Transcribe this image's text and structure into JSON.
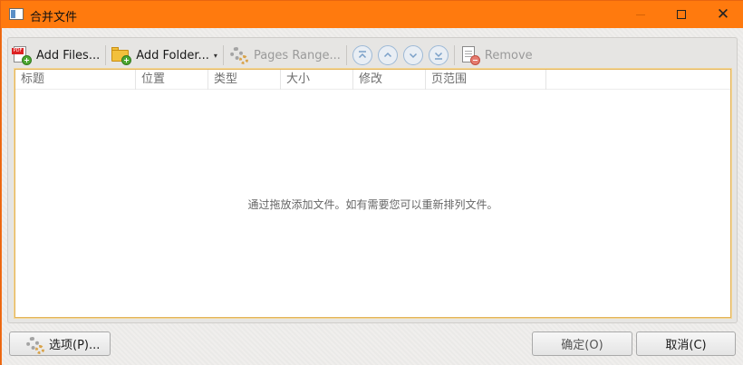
{
  "window": {
    "title": "合并文件",
    "minimize_icon": "minimize-icon",
    "maximize_icon": "maximize-icon",
    "close_icon": "close-icon",
    "close_glyph": "✕"
  },
  "toolbar": {
    "add_files_label": "Add Files...",
    "add_folder_label": "Add Folder...",
    "add_folder_caret": "▾",
    "pages_range_label": "Pages Range...",
    "remove_label": "Remove",
    "nav_icons": [
      "move-to-top-icon",
      "move-up-icon",
      "move-down-icon",
      "move-to-bottom-icon"
    ]
  },
  "list": {
    "columns": [
      "标题",
      "位置",
      "类型",
      "大小",
      "修改",
      "页范围"
    ],
    "empty_message": "通过拖放添加文件。如有需要您可以重新排列文件。"
  },
  "buttons": {
    "options_label": "选项(P)...",
    "ok_label": "确定(O)",
    "cancel_label": "取消(C)"
  },
  "colors": {
    "titlebar": "#ff7a0e",
    "list_border": "#e3b45a",
    "nav_button_border": "#9db9d6"
  }
}
